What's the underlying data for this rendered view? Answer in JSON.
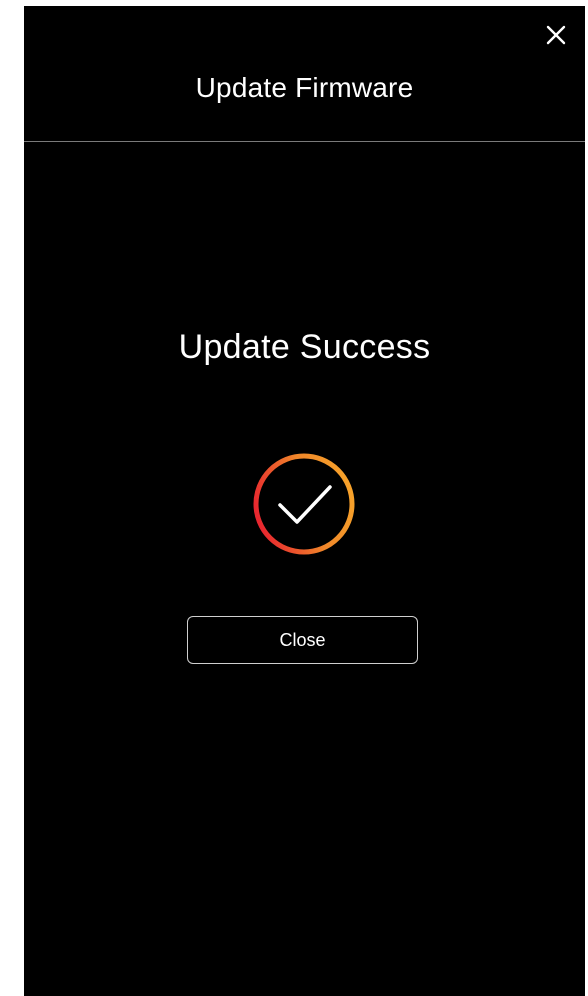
{
  "header": {
    "title": "Update Firmware",
    "close_icon": "close-icon"
  },
  "status": {
    "title": "Update Success",
    "icon": "check-circle-icon",
    "gradient_colors": [
      "#e8262f",
      "#f0862a",
      "#f7a32a"
    ]
  },
  "actions": {
    "close_label": "Close"
  }
}
